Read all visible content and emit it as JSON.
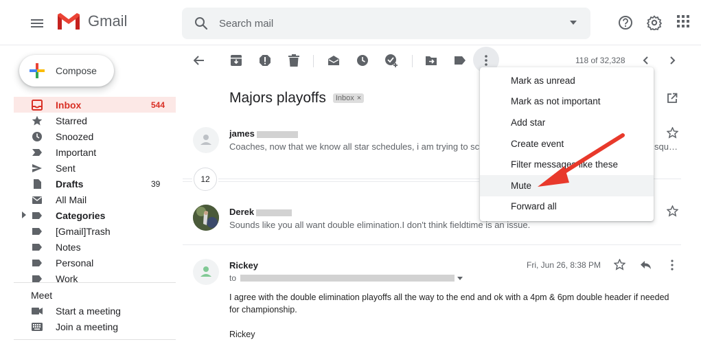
{
  "header": {
    "app_name": "Gmail",
    "search_placeholder": "Search mail",
    "icons": [
      "menu-icon",
      "search-icon",
      "dropdown-icon",
      "help-icon",
      "settings-icon",
      "apps-icon"
    ]
  },
  "compose": {
    "label": "Compose"
  },
  "sidebar": {
    "items": [
      {
        "label": "Inbox",
        "count": "544",
        "icon": "inbox-icon"
      },
      {
        "label": "Starred",
        "count": "",
        "icon": "star-icon"
      },
      {
        "label": "Snoozed",
        "count": "",
        "icon": "clock-icon"
      },
      {
        "label": "Important",
        "count": "",
        "icon": "important-icon"
      },
      {
        "label": "Sent",
        "count": "",
        "icon": "send-icon"
      },
      {
        "label": "Drafts",
        "count": "39",
        "icon": "draft-icon"
      },
      {
        "label": "All Mail",
        "count": "",
        "icon": "mail-icon"
      },
      {
        "label": "Categories",
        "count": "",
        "icon": "label-icon"
      },
      {
        "label": "[Gmail]Trash",
        "count": "",
        "icon": "label-icon"
      },
      {
        "label": "Notes",
        "count": "",
        "icon": "label-icon"
      },
      {
        "label": "Personal",
        "count": "",
        "icon": "label-icon"
      },
      {
        "label": "Work",
        "count": "",
        "icon": "label-icon"
      }
    ],
    "meet": {
      "title": "Meet",
      "start": "Start a meeting",
      "join": "Join a meeting"
    }
  },
  "toolbar": {
    "pager": "118 of 32,328",
    "icons": [
      "back-icon",
      "archive-icon",
      "report-spam-icon",
      "delete-icon",
      "mark-unread-icon",
      "snooze-icon",
      "add-task-icon",
      "move-to-icon",
      "labels-icon",
      "more-icon",
      "prev-icon",
      "next-icon"
    ]
  },
  "thread": {
    "subject": "Majors playoffs",
    "label_badge": "Inbox",
    "collapsed_count": "12",
    "messages": [
      {
        "sender": "james",
        "snippet": "Coaches, now that we know all star schedules, i am trying to sch",
        "snippet_tail": "squ…"
      },
      {
        "sender": "Derek",
        "snippet": "Sounds like you all want double elimination.I don't think fieldtime is an issue."
      },
      {
        "sender": "Rickey",
        "date": "Fri, Jun 26, 8:38 PM",
        "to_prefix": "to",
        "body_line1": "I agree with the double elimination playoffs all the way to the end and ok with a 4pm & 6pm double header if needed",
        "body_line2": "for championship.",
        "signature": "Rickey"
      }
    ]
  },
  "menu": {
    "items": [
      "Mark as unread",
      "Mark as not important",
      "Add star",
      "Create event",
      "Filter messages like these",
      "Mute",
      "Forward all"
    ],
    "highlighted": "Mute"
  },
  "colors": {
    "accent_red": "#d93025",
    "inbox_active_bg": "#fce8e6",
    "arrow_red": "#e8392b"
  }
}
